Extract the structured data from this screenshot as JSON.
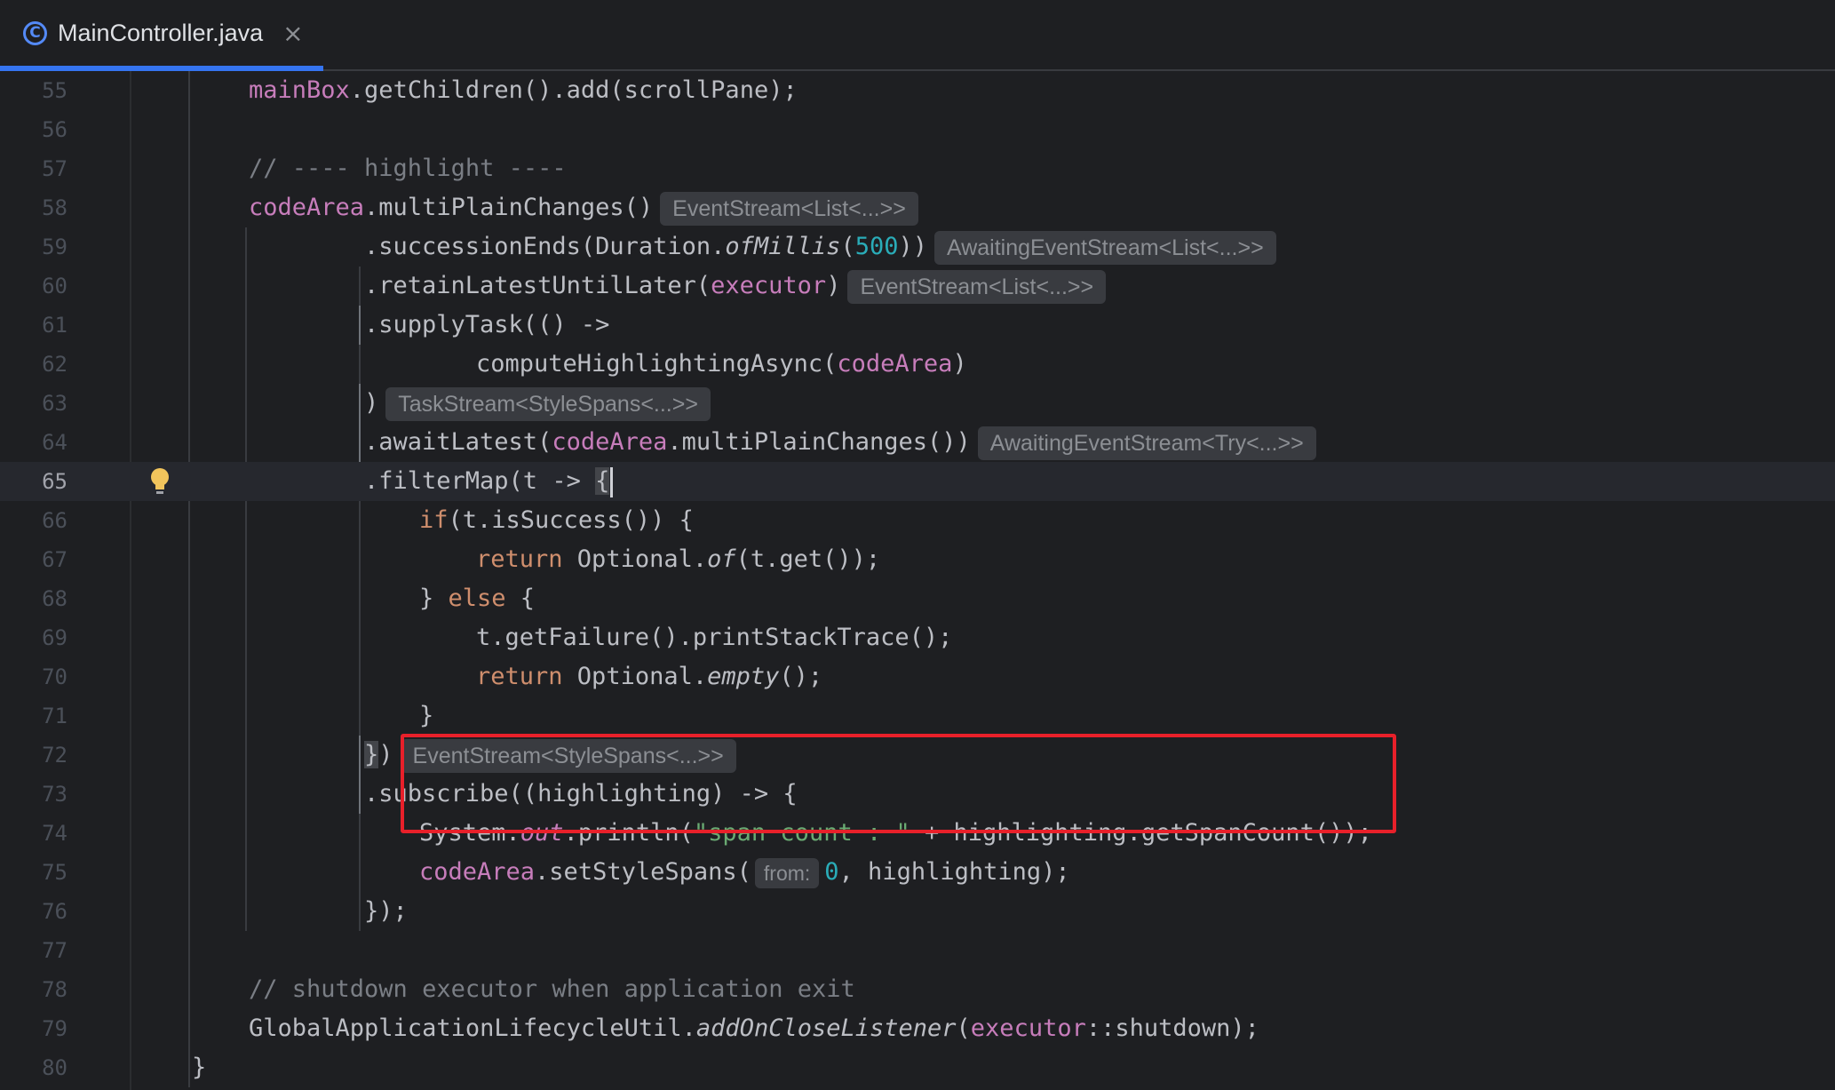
{
  "tab": {
    "title": "MainController.java",
    "icon_glyph": "C",
    "icon": "java-class-icon",
    "close_icon": "close-icon",
    "accent_color": "#3574f0"
  },
  "editor": {
    "current_line": "65",
    "lines": [
      {
        "no": "55",
        "tokens": [
          {
            "t": "mainBox",
            "c": "fld"
          },
          {
            "t": ".getChildren().add(scrollPane);"
          }
        ]
      },
      {
        "no": "56",
        "tokens": []
      },
      {
        "no": "57",
        "tokens": [
          {
            "t": "// ---- highlight ----",
            "c": "cmt"
          }
        ]
      },
      {
        "no": "58",
        "tokens": [
          {
            "t": "codeArea",
            "c": "fld"
          },
          {
            "t": ".multiPlainChanges()"
          },
          {
            "t": "EventStream<List<...>>",
            "c": "hint"
          }
        ]
      },
      {
        "no": "59",
        "tokens": [
          {
            "t": ".successionEnds(Duration."
          },
          {
            "t": "ofMillis",
            "c": "ital"
          },
          {
            "t": "("
          },
          {
            "t": "500",
            "c": "num"
          },
          {
            "t": "))"
          },
          {
            "t": "AwaitingEventStream<List<...>>",
            "c": "hint"
          }
        ]
      },
      {
        "no": "60",
        "tokens": [
          {
            "t": ".retainLatestUntilLater("
          },
          {
            "t": "executor",
            "c": "fld"
          },
          {
            "t": ")"
          },
          {
            "t": "EventStream<List<...>>",
            "c": "hint"
          }
        ]
      },
      {
        "no": "61",
        "tokens": [
          {
            "t": ".supplyTask(() ->"
          }
        ]
      },
      {
        "no": "62",
        "tokens": [
          {
            "t": "computeHighlightingAsync("
          },
          {
            "t": "codeArea",
            "c": "fld"
          },
          {
            "t": ")"
          }
        ]
      },
      {
        "no": "63",
        "tokens": [
          {
            "t": ")"
          },
          {
            "t": "TaskStream<StyleSpans<...>>",
            "c": "hint"
          }
        ]
      },
      {
        "no": "64",
        "tokens": [
          {
            "t": ".awaitLatest("
          },
          {
            "t": "codeArea",
            "c": "fld"
          },
          {
            "t": ".multiPlainChanges())"
          },
          {
            "t": "AwaitingEventStream<Try<...>>",
            "c": "hint"
          }
        ]
      },
      {
        "no": "65",
        "tokens": [
          {
            "t": ".filterMap(t -> "
          },
          {
            "t": "{",
            "c": "brace-hl"
          },
          {
            "t": "",
            "c": "caret"
          }
        ]
      },
      {
        "no": "66",
        "tokens": [
          {
            "t": "if",
            "c": "kw"
          },
          {
            "t": "(t.isSuccess()) {"
          }
        ]
      },
      {
        "no": "67",
        "tokens": [
          {
            "t": "return",
            "c": "kw"
          },
          {
            "t": " Optional."
          },
          {
            "t": "of",
            "c": "ital"
          },
          {
            "t": "(t.get());"
          }
        ]
      },
      {
        "no": "68",
        "tokens": [
          {
            "t": "} "
          },
          {
            "t": "else",
            "c": "kw"
          },
          {
            "t": " {"
          }
        ]
      },
      {
        "no": "69",
        "tokens": [
          {
            "t": "t.getFailure().printStackTrace();"
          }
        ]
      },
      {
        "no": "70",
        "tokens": [
          {
            "t": "return",
            "c": "kw"
          },
          {
            "t": " Optional."
          },
          {
            "t": "empty",
            "c": "ital"
          },
          {
            "t": "();"
          }
        ]
      },
      {
        "no": "71",
        "tokens": [
          {
            "t": "}"
          }
        ]
      },
      {
        "no": "72",
        "tokens": [
          {
            "t": "}",
            "c": "brace-hl"
          },
          {
            "t": ")"
          },
          {
            "t": "EventStream<StyleSpans<...>>",
            "c": "hint"
          }
        ]
      },
      {
        "no": "73",
        "tokens": [
          {
            "t": ".subscribe((highlighting) -> {"
          }
        ]
      },
      {
        "no": "74",
        "tokens": [
          {
            "t": "System."
          },
          {
            "t": "out",
            "c": "fld ital"
          },
          {
            "t": ".println("
          },
          {
            "t": "\"span count : \"",
            "c": "str"
          },
          {
            "t": " + highlighting.getSpanCount());"
          }
        ]
      },
      {
        "no": "75",
        "tokens": [
          {
            "t": "codeArea",
            "c": "fld"
          },
          {
            "t": ".setStyleSpans("
          },
          {
            "t": "from:",
            "c": "param-hint"
          },
          {
            "t": "0",
            "c": "num"
          },
          {
            "t": ", highlighting);"
          }
        ]
      },
      {
        "no": "76",
        "tokens": [
          {
            "t": "});"
          }
        ]
      },
      {
        "no": "77",
        "tokens": []
      },
      {
        "no": "78",
        "tokens": [
          {
            "t": "// shutdown executor when application exit",
            "c": "cmt"
          }
        ]
      },
      {
        "no": "79",
        "tokens": [
          {
            "t": "GlobalApplicationLifecycleUtil."
          },
          {
            "t": "addOnCloseListener",
            "c": "ital"
          },
          {
            "t": "("
          },
          {
            "t": "executor",
            "c": "fld"
          },
          {
            "t": "::shutdown);"
          }
        ]
      },
      {
        "no": "80",
        "tokens": [
          {
            "t": "}"
          }
        ]
      }
    ]
  },
  "gutter": {
    "intention_icon": "lightbulb-icon",
    "bulb_color": "#f2c55c"
  },
  "annotation": {
    "color": "#e8202a",
    "lines": [
      "74",
      "75"
    ]
  },
  "colors": {
    "background": "#1e1f22",
    "text": "#bcbec4",
    "field": "#c77dbb",
    "keyword": "#cf8e6d",
    "string": "#6aab73",
    "number": "#2aacb8",
    "comment": "#7a7e85"
  }
}
